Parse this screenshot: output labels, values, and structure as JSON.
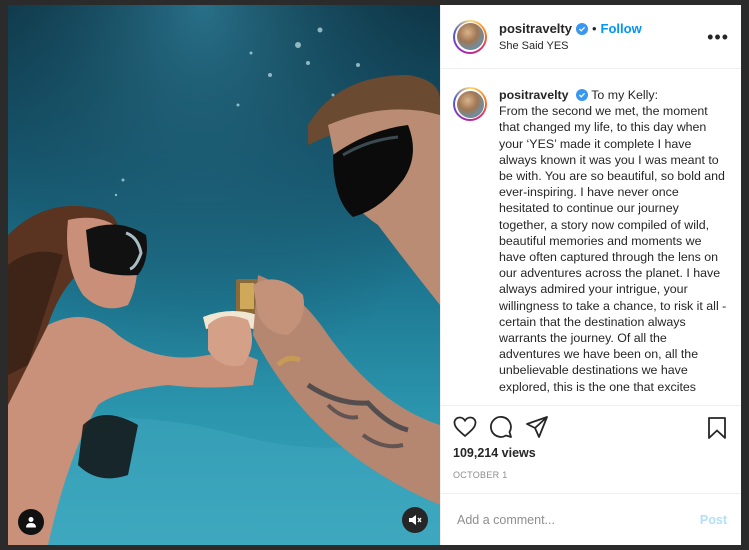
{
  "post": {
    "username": "positravelty",
    "follow_label": "Follow",
    "separator": "•",
    "location": "She Said YES",
    "more_label": "•••",
    "caption_greeting": "To my Kelly:",
    "caption_body": "From the second we met, the moment that changed my life, to this day when your ‘YES’ made it complete I have always known it was you I was meant to be with. You are so beautiful, so bold and ever-inspiring. I have never once hesitated to continue our journey together, a story now compiled of wild, beautiful memories and moments we have often captured through the lens on our adventures across the planet. I have always admired your intrigue, your willingness to take a chance, to risk it all - certain that the destination always warrants the journey. Of all the adventures we have been on, all the unbelievable destinations we have explored, this is the one that excites",
    "views": "109,214 views",
    "date": "OCTOBER 1"
  },
  "comment": {
    "placeholder": "Add a comment...",
    "post_label": "Post"
  },
  "icons": {
    "like": "heart-icon",
    "comment": "comment-icon",
    "share": "share-icon",
    "save": "bookmark-icon",
    "user_tag": "user-icon",
    "mute": "muted-speaker-icon",
    "verified": "verified-badge-icon"
  },
  "colors": {
    "link": "#0095f6",
    "verified": "#3897f0",
    "post_disabled": "#b2dffc",
    "water_dark": "#0d3344",
    "water_light": "#3aa5bd"
  }
}
